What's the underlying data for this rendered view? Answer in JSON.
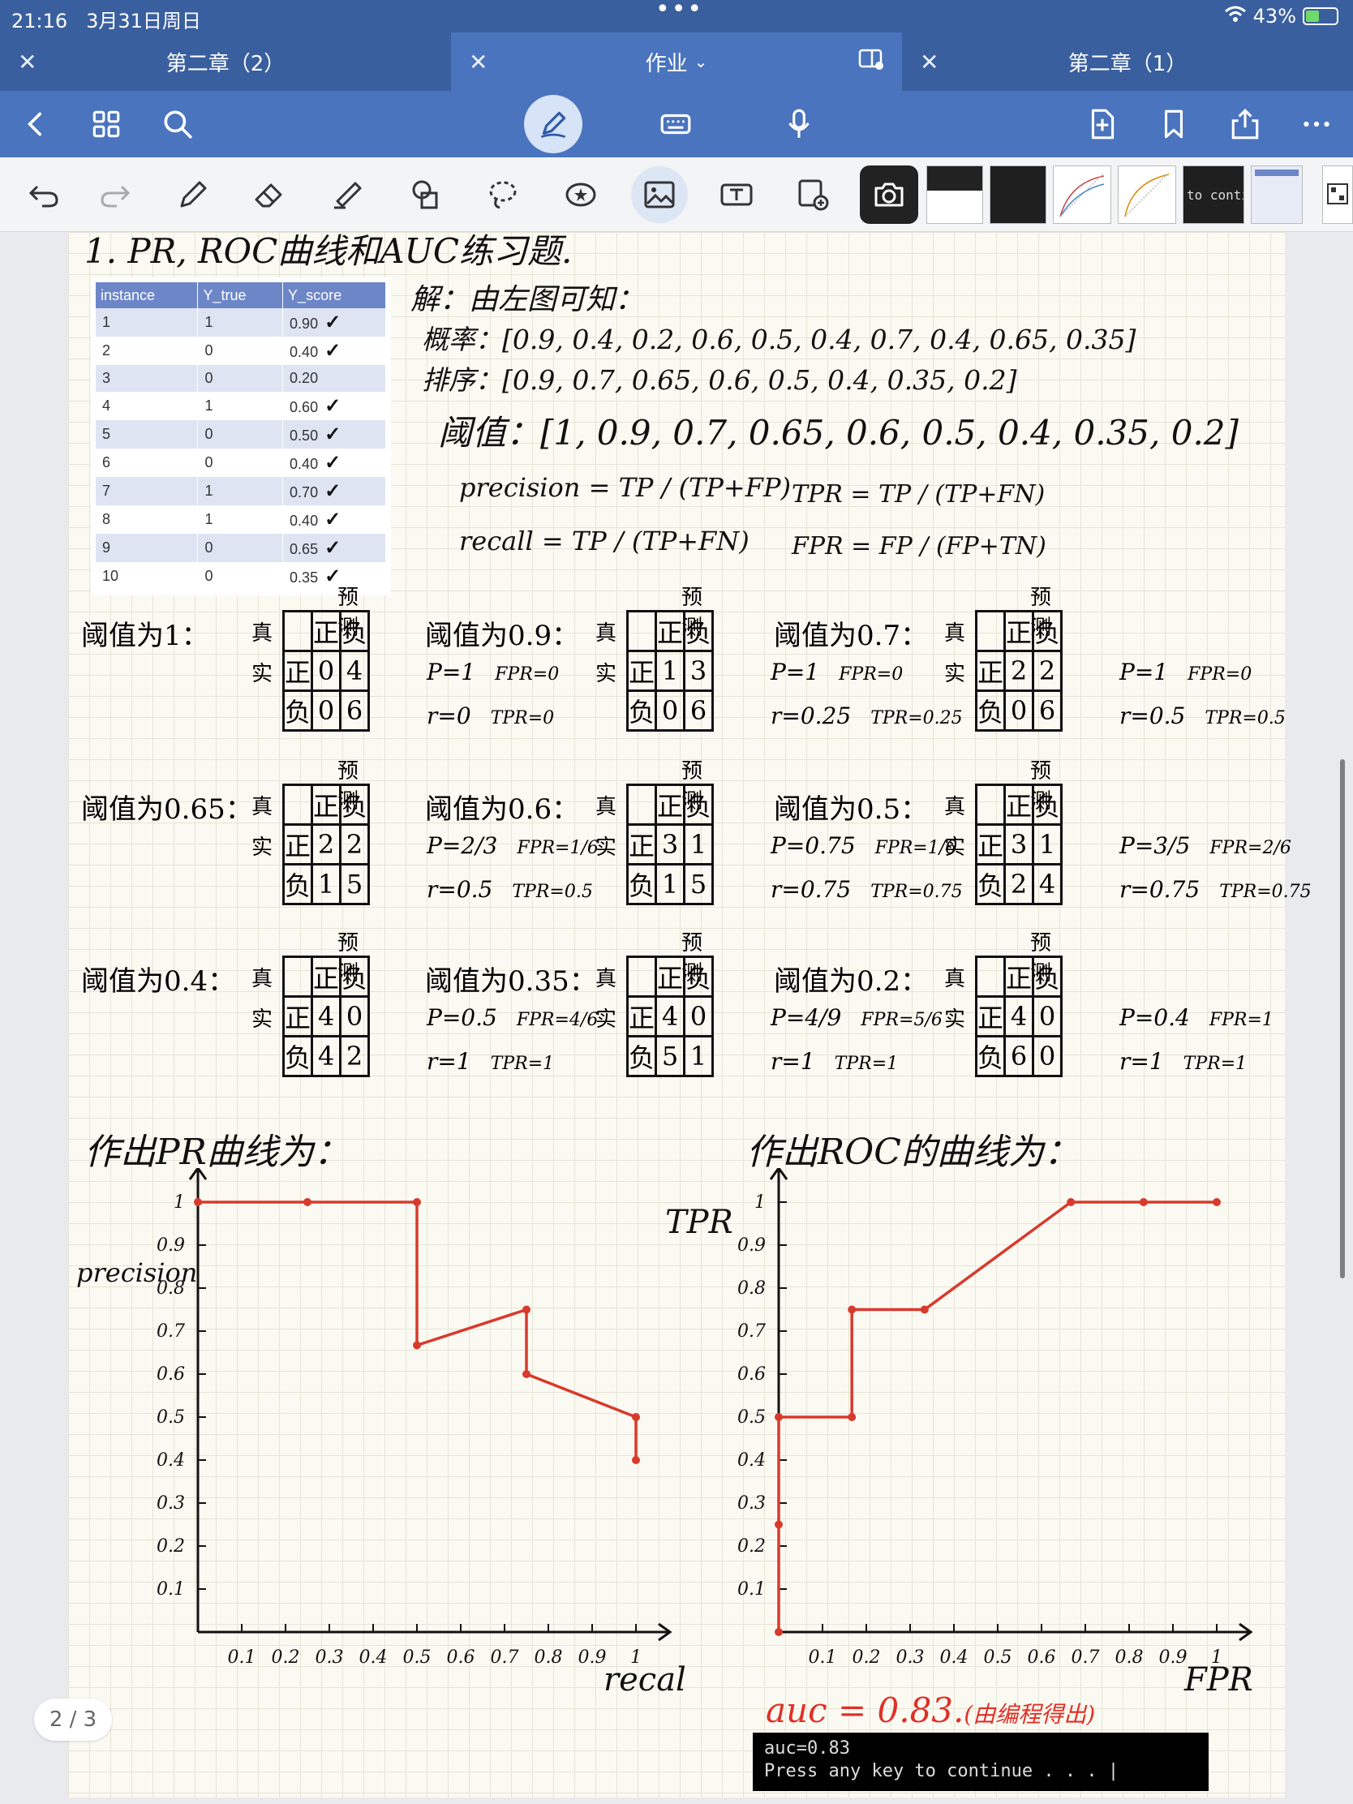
{
  "status": {
    "time": "21:16",
    "date": "3月31日周日",
    "battery": "43%"
  },
  "tabs": [
    {
      "label": "第二章（2）"
    },
    {
      "label": "作业"
    },
    {
      "label": "第二章（1）"
    }
  ],
  "colors": {
    "bar": "#3a5f9f",
    "toolbar": "#4a74bd",
    "ink_red": "#d83a2c"
  },
  "icons": {
    "toolbar": [
      "back-icon",
      "grid-icon",
      "search-icon",
      "pen-icon",
      "keyboard-icon",
      "microphone-icon",
      "add-page-icon",
      "bookmark-icon",
      "share-icon",
      "more-icon"
    ],
    "tools": [
      "undo-icon",
      "redo-icon",
      "pencil-icon",
      "eraser-icon",
      "highlighter-icon",
      "shapes-icon",
      "lasso-icon",
      "sticker-icon",
      "image-icon",
      "text-icon",
      "scan-icon",
      "camera-icon"
    ]
  },
  "thumbnail_text": "to conti",
  "page_indicator": "2 / 3",
  "notes": {
    "title": "1. PR, ROC曲线和AUC练习题.",
    "solution_intro": "解：由左图可知：",
    "prob_line": "概率：[0.9, 0.4, 0.2, 0.6, 0.5, 0.4, 0.7, 0.4, 0.65, 0.35]",
    "sorted_line": "排序：[0.9, 0.7, 0.65, 0.6, 0.5, 0.4, 0.35, 0.2]",
    "threshold_line": "阈值：[1, 0.9, 0.7, 0.65, 0.6, 0.5, 0.4, 0.35, 0.2]",
    "precision_formula": "precision =  TP / (TP+FP)",
    "recall_formula": "recall =  TP / (TP+FN)",
    "tpr_formula": "TPR =  TP / (TP+FN)",
    "fpr_formula": "FPR =  FP / (FP+TN)",
    "pr_heading": "作出PR曲线为：",
    "roc_heading": "作出ROC的曲线为：",
    "auc_note": "auc = 0.83.",
    "auc_note_paren": "(由编程得出)"
  },
  "table": {
    "headers": [
      "instance",
      "Y_true",
      "Y_score"
    ],
    "rows": [
      [
        "1",
        "1",
        "0.90"
      ],
      [
        "2",
        "0",
        "0.40"
      ],
      [
        "3",
        "0",
        "0.20"
      ],
      [
        "4",
        "1",
        "0.60"
      ],
      [
        "5",
        "0",
        "0.50"
      ],
      [
        "6",
        "0",
        "0.40"
      ],
      [
        "7",
        "1",
        "0.70"
      ],
      [
        "8",
        "1",
        "0.40"
      ],
      [
        "9",
        "0",
        "0.65"
      ],
      [
        "10",
        "0",
        "0.35"
      ]
    ],
    "checked": [
      true,
      true,
      false,
      true,
      true,
      true,
      true,
      true,
      true,
      true
    ]
  },
  "matrices": [
    {
      "label": "阈值为1：",
      "cells": [
        "0",
        "4",
        "0",
        "6"
      ],
      "p": "P=1",
      "r": "r=0",
      "fpr": "FPR=0",
      "tpr": "TPR=0"
    },
    {
      "label": "阈值为0.9：",
      "cells": [
        "1",
        "3",
        "0",
        "6"
      ],
      "p": "P=1",
      "r": "r=0.25",
      "fpr": "FPR=0",
      "tpr": "TPR=0.25"
    },
    {
      "label": "阈值为0.7：",
      "cells": [
        "2",
        "2",
        "0",
        "6"
      ],
      "p": "P=1",
      "r": "r=0.5",
      "fpr": "FPR=0",
      "tpr": "TPR=0.5"
    },
    {
      "label": "阈值为0.65：",
      "cells": [
        "2",
        "2",
        "1",
        "5"
      ],
      "p": "P=2/3",
      "r": "r=0.5",
      "fpr": "FPR=1/6",
      "tpr": "TPR=0.5"
    },
    {
      "label": "阈值为0.6：",
      "cells": [
        "3",
        "1",
        "1",
        "5"
      ],
      "p": "P=0.75",
      "r": "r=0.75",
      "fpr": "FPR=1/6",
      "tpr": "TPR=0.75"
    },
    {
      "label": "阈值为0.5：",
      "cells": [
        "3",
        "1",
        "2",
        "4"
      ],
      "p": "P=3/5",
      "r": "r=0.75",
      "fpr": "FPR=2/6",
      "tpr": "TPR=0.75"
    },
    {
      "label": "阈值为0.4：",
      "cells": [
        "4",
        "0",
        "4",
        "2"
      ],
      "p": "P=0.5",
      "r": "r=1",
      "fpr": "FPR=4/6",
      "tpr": "TPR=1"
    },
    {
      "label": "阈值为0.35：",
      "cells": [
        "4",
        "0",
        "5",
        "1"
      ],
      "p": "P=4/9",
      "r": "r=1",
      "fpr": "FPR=5/6",
      "tpr": "TPR=1"
    },
    {
      "label": "阈值为0.2：",
      "cells": [
        "4",
        "0",
        "6",
        "0"
      ],
      "p": "P=0.4",
      "r": "r=1",
      "fpr": "FPR=1",
      "tpr": "TPR=1"
    }
  ],
  "matrix_labels": {
    "predicted": "预测",
    "actual_top": "真",
    "actual_bottom": "实",
    "pos": "正",
    "neg": "负"
  },
  "terminal": {
    "line1": "auc=0.83",
    "line2": "Press any key to continue . . . |"
  },
  "chart_data": [
    {
      "type": "line",
      "title": "",
      "xlabel": "recall",
      "ylabel": "precision",
      "xlim": [
        0,
        1
      ],
      "ylim": [
        0,
        1
      ],
      "x_ticks": [
        "0.1",
        "0.2",
        "0.3",
        "0.4",
        "0.5",
        "0.6",
        "0.7",
        "0.8",
        "0.9",
        "1"
      ],
      "y_ticks": [
        "0.1",
        "0.2",
        "0.3",
        "0.4",
        "0.5",
        "0.6",
        "0.7",
        "0.8",
        "0.9",
        "1"
      ],
      "series": [
        {
          "color": "#d83a2c",
          "x": [
            0,
            0.25,
            0.5,
            0.5,
            0.75,
            0.75,
            1,
            1
          ],
          "y": [
            1,
            1,
            1,
            0.667,
            0.75,
            0.6,
            0.5,
            0.4
          ]
        }
      ]
    },
    {
      "type": "line",
      "title": "",
      "xlabel": "FPR",
      "ylabel": "TPR",
      "xlim": [
        0,
        1
      ],
      "ylim": [
        0,
        1
      ],
      "x_ticks": [
        "0.1",
        "0.2",
        "0.3",
        "0.4",
        "0.5",
        "0.6",
        "0.7",
        "0.8",
        "0.9",
        "1"
      ],
      "y_ticks": [
        "0.1",
        "0.2",
        "0.3",
        "0.4",
        "0.5",
        "0.6",
        "0.7",
        "0.8",
        "0.9",
        "1"
      ],
      "series": [
        {
          "color": "#d83a2c",
          "x": [
            0,
            0,
            0,
            0.167,
            0.167,
            0.333,
            0.667,
            0.833,
            1
          ],
          "y": [
            0,
            0.25,
            0.5,
            0.5,
            0.75,
            0.75,
            1,
            1,
            1
          ]
        }
      ]
    }
  ]
}
